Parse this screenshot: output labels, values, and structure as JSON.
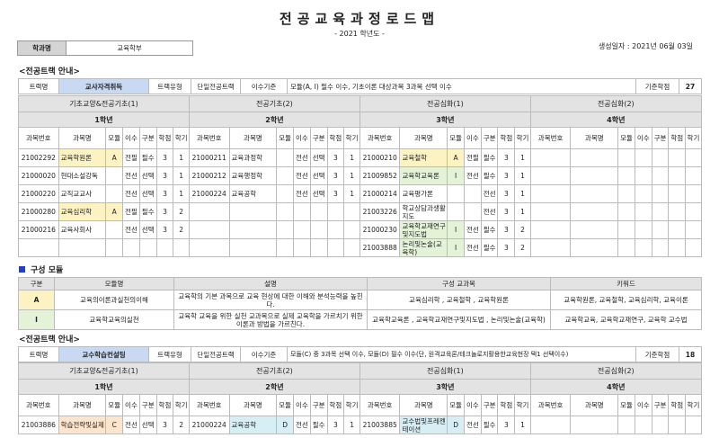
{
  "header": {
    "title": "전공교육과정로드맵",
    "subtitle": "- 2021 학년도 -",
    "dept_label": "학과명",
    "dept_value": "교육학부",
    "generated": "생성일자 : 2021년 06월 03일"
  },
  "track_section_label": "<전공트랙 안내>",
  "labels": {
    "track": "트랙명",
    "track_type": "트랙유형",
    "single": "단일전공트랙",
    "criteria": "이수기준",
    "credits": "기준학점"
  },
  "cols": {
    "no": "과목번호",
    "name": "과목명",
    "module": "모듈",
    "isu": "이수",
    "gubun": "구분",
    "hakjeom": "학점",
    "hakgi": "학기"
  },
  "track1": {
    "name": "교사자격취득",
    "criteria": "모듈(A, I) 필수 이수, 기초이론 대상과목 3과목 선택 이수",
    "credits": "27",
    "groups": [
      "기초교양&전공기초(1)",
      "전공기초(2)",
      "전공심화(1)",
      "전공심화(2)"
    ],
    "years": [
      "1학년",
      "2학년",
      "3학년",
      "4학년"
    ],
    "rows": [
      [
        [
          "21002292",
          "교육학원론",
          "A",
          "전필",
          "필수",
          "3",
          "1"
        ],
        [
          "21000211",
          "교육과정학",
          "",
          "전선",
          "선택",
          "3",
          "1"
        ],
        [
          "21000210",
          "교육철학",
          "A",
          "전필",
          "필수",
          "3",
          "1"
        ],
        [
          "",
          "",
          "",
          "",
          "",
          "",
          ""
        ]
      ],
      [
        [
          "21000020",
          "현대소설강독",
          "",
          "전선",
          "선택",
          "3",
          "1"
        ],
        [
          "21000212",
          "교육행정학",
          "",
          "전선",
          "선택",
          "3",
          "1"
        ],
        [
          "21009852",
          "교육학교육론",
          "I",
          "전선",
          "필수",
          "3",
          "1"
        ],
        [
          "",
          "",
          "",
          "",
          "",
          "",
          ""
        ]
      ],
      [
        [
          "21000220",
          "교직교교사",
          "",
          "전선",
          "선택",
          "3",
          "1"
        ],
        [
          "21000224",
          "교육공학",
          "",
          "전선",
          "선택",
          "3",
          "1"
        ],
        [
          "21000214",
          "교육평가론",
          "",
          "",
          "전선",
          "3",
          "1"
        ],
        [
          "",
          "",
          "",
          "",
          "",
          "",
          ""
        ]
      ],
      [
        [
          "21000280",
          "교육심리학",
          "A",
          "전필",
          "필수",
          "3",
          "2"
        ],
        [
          "",
          "",
          "",
          "",
          "",
          "",
          ""
        ],
        [
          "21003226",
          "학교상담과생활지도",
          "",
          "",
          "전선",
          "3",
          "1"
        ],
        [
          "",
          "",
          "",
          "",
          "",
          "",
          ""
        ]
      ],
      [
        [
          "21000216",
          "교육사회사",
          "",
          "전선",
          "선택",
          "3",
          "2"
        ],
        [
          "",
          "",
          "",
          "",
          "",
          "",
          ""
        ],
        [
          "21000230",
          "교육학교재연구및지도법",
          "I",
          "전선",
          "필수",
          "3",
          "2"
        ],
        [
          "",
          "",
          "",
          "",
          "",
          "",
          ""
        ]
      ],
      [
        [
          "",
          "",
          "",
          "",
          "",
          "",
          ""
        ],
        [
          "",
          "",
          "",
          "",
          "",
          "",
          ""
        ],
        [
          "21003888",
          "논리및논술(교육학)",
          "I",
          "전선",
          "필수",
          "3",
          "2"
        ],
        [
          "",
          "",
          "",
          "",
          "",
          "",
          ""
        ]
      ]
    ]
  },
  "modules_title": "구성 모듈",
  "module_headers": [
    "구분",
    "모듈명",
    "설명",
    "구성 교과목",
    "키워드"
  ],
  "modules": [
    {
      "code": "A",
      "name": "교육의이론과실천의이해",
      "desc": "교육학의 기본 과목으로 교육 현상에 대한 이해와 분석능력을 높힌다.",
      "courses": "교육심리학 , 교육철학 , 교육학원론",
      "keywords": "교육학원론, 교육철학, 교육심리학, 교육이론"
    },
    {
      "code": "I",
      "name": "교육학교육의실천",
      "desc": "교육학 교육을 위한 실천 교과목으로 실제 교육학을 가르치기 위한 이론과 방법을 가르친다.",
      "courses": "교육학교육론 , 교육학교재연구및지도법 , 논리및논술(교육학)",
      "keywords": "교육학교육, 교육학교재연구, 교육학 교수법"
    }
  ],
  "track2": {
    "name": "교수학습컨설팅",
    "criteria": "모듈(C) 중 3과목 선택 이수, 모듈(D) 필수 이수(단, 원격교육론/테크놀로지활용한교육현장 택1 선택이수)",
    "credits": "18",
    "groups": [
      "기초교양&전공기초(1)",
      "전공기초(2)",
      "전공심화(1)",
      "전공심화(2)"
    ],
    "years": [
      "1학년",
      "2학년",
      "3학년",
      "4학년"
    ],
    "rows": [
      [
        [
          "21003886",
          "학습전략및실제",
          "C",
          "전선",
          "선택",
          "3",
          "2"
        ],
        [
          "21000224",
          "교육공학",
          "D",
          "전선",
          "필수",
          "3",
          "1"
        ],
        [
          "21003885",
          "교수법및프레젠테이션",
          "D",
          "전선",
          "필수",
          "3",
          "1"
        ],
        [
          "",
          "",
          "",
          "",
          "",
          "",
          ""
        ]
      ]
    ]
  }
}
